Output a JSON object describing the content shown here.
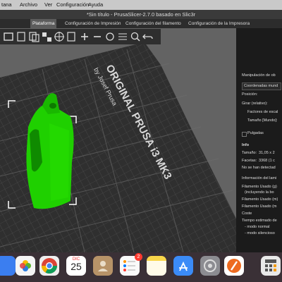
{
  "menubar": {
    "items": [
      "tana",
      "Archivo",
      "Ver",
      "Configuración",
      "Ayuda"
    ]
  },
  "window": {
    "title": "*Sin título - PrusaSlicer-2.7.0 basado en Slic3r"
  },
  "tabs": [
    {
      "label": "Plataforma",
      "active": true
    },
    {
      "label": "Configuración de Impresión",
      "active": false
    },
    {
      "label": "Configuración del filamento",
      "active": false
    },
    {
      "label": "Configuración de la Impresora",
      "active": false
    }
  ],
  "toolbar": {
    "icons": [
      "add-object-icon",
      "delete-icon",
      "delete-all-icon",
      "arrange-icon",
      "copy-icon",
      "paste-icon",
      "add-instance-icon",
      "remove-instance-icon",
      "split-icon",
      "layers-editing-icon",
      "search-icon",
      "variable-layer-height-icon",
      "undo-icon"
    ]
  },
  "bed": {
    "text_lines": [
      "ORIGINAL PRUSA i3 MK3",
      "by Josef Prusa"
    ]
  },
  "right_panel": {
    "manip_heading": "Manipulación de ob",
    "coords_select": "Coordenadas mund",
    "posicion": "Posición:",
    "girar": "Girar (relativo):",
    "factores": "Factores de escal",
    "tamano_mundo": "Tamaño [Mundo]:",
    "pulgadas": "Pulgadas",
    "info_heading": "Info",
    "tamano_label": "Tamaño:",
    "tamano_value": "31,05 x 2",
    "facetas_label": "Facetas:",
    "facetas_value": "3368 (1 c",
    "no_se_ha": "No se han detectad",
    "info_lam": "Información del lami",
    "fil_g1": "Filamento Usado (g)",
    "fil_g2": "(incluyendo la bo",
    "fil_m": "Filamento Usado (m)",
    "fil_mm": "Filamento Usado (m",
    "coste": "Coste",
    "tiempo": "Tiempo estimado de",
    "modo_normal": "- modo normal",
    "modo_silencioso": "- modo silencioso"
  },
  "dock": {
    "calendar_month": "DIC",
    "calendar_day": "25",
    "reminders_badge": "2",
    "icons": [
      "photos-icon",
      "chrome-icon",
      "calendar-icon",
      "contacts-icon",
      "reminders-icon",
      "notes-icon",
      "keynote-icon",
      "app-store-icon",
      "settings-icon",
      "prusaslicer-icon",
      "calculator-icon"
    ]
  },
  "colors": {
    "model_green": "#1fd000",
    "bed": "#2f2f2f",
    "panel": "#1b1b1b",
    "active_tab": "#5c5c5c"
  }
}
